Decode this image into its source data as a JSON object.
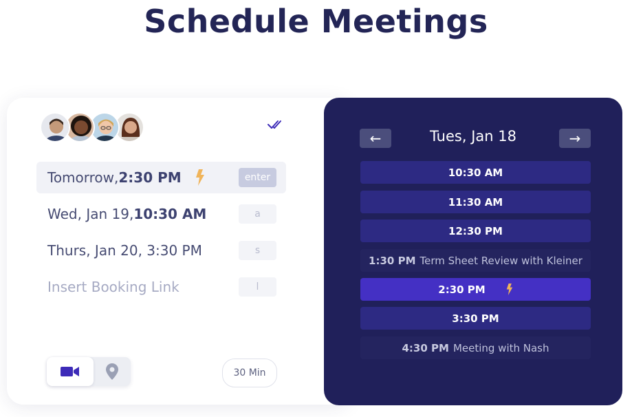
{
  "page": {
    "title": "Schedule Meetings"
  },
  "left": {
    "avatars": [
      {
        "name": "avatar-1",
        "skin": "#c49a7a",
        "hair": "#3a2a20",
        "shirt": "#36456a"
      },
      {
        "name": "avatar-2",
        "skin": "#7a4a30",
        "hair": "#1e140e",
        "shirt": "#b6c4d4"
      },
      {
        "name": "avatar-3",
        "skin": "#f0c7a8",
        "hair": "#d2a65a",
        "shirt": "#23374d"
      },
      {
        "name": "avatar-4",
        "skin": "#d9a88a",
        "hair": "#5a2e1c",
        "shirt": "#cfc7bf"
      }
    ],
    "options": [
      {
        "prefix": "Tomorrow, ",
        "bold": "2:30 PM",
        "suffix": "",
        "key": "enter",
        "selected": true,
        "bolt": true
      },
      {
        "prefix": "Wed, Jan 19, ",
        "bold": "10:30 AM",
        "suffix": "",
        "key": "a",
        "selected": false,
        "bolt": false
      },
      {
        "prefix": "Thurs, Jan 20, 3:30 PM",
        "bold": "",
        "suffix": "",
        "key": "s",
        "selected": false,
        "bolt": false
      },
      {
        "prefix": "Insert Booking Link",
        "bold": "",
        "suffix": "",
        "key": "l",
        "selected": false,
        "bolt": false
      }
    ],
    "duration": "30 Min",
    "toggle": {
      "selected": "video",
      "icons": [
        "video-camera-icon",
        "map-pin-icon"
      ]
    },
    "check_icon": "double-check-icon"
  },
  "right": {
    "prev_label": "←",
    "next_label": "→",
    "date": "Tues, Jan 18",
    "slots": [
      {
        "time": "10:30 AM",
        "event": "",
        "state": "free"
      },
      {
        "time": "11:30 AM",
        "event": "",
        "state": "free"
      },
      {
        "time": "12:30 PM",
        "event": "",
        "state": "free"
      },
      {
        "time": "1:30 PM",
        "event": "Term Sheet Review with Kleiner",
        "state": "busy"
      },
      {
        "time": "2:30 PM",
        "event": "",
        "state": "active"
      },
      {
        "time": "3:30 PM",
        "event": "",
        "state": "free"
      },
      {
        "time": "4:30 PM",
        "event": "Meeting with Nash",
        "state": "busy"
      }
    ]
  },
  "colors": {
    "title": "#232556",
    "panel": "#20205a",
    "slot": "#2d2a83",
    "slot_active": "#4430c4",
    "bolt": "#f0b45a",
    "video_icon": "#3d2bb8"
  }
}
